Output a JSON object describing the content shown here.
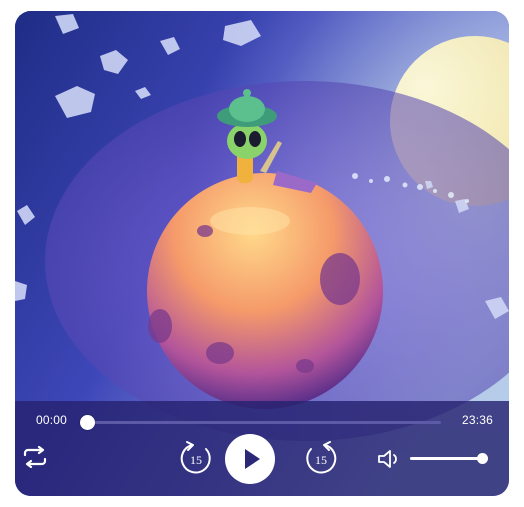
{
  "player": {
    "current_time": "00:00",
    "total_time": "23:36",
    "progress_fraction": 0.0,
    "volume_fraction": 1.0,
    "rewind_seconds": "15",
    "forward_seconds": "15"
  },
  "icons": {
    "repeat": "repeat-icon",
    "rewind": "rewind-15-icon",
    "play": "play-icon",
    "forward": "forward-15-icon",
    "volume": "volume-icon"
  },
  "colors": {
    "control_bar": "#262270",
    "accent": "#ffffff",
    "track": "#5d5aa8"
  }
}
